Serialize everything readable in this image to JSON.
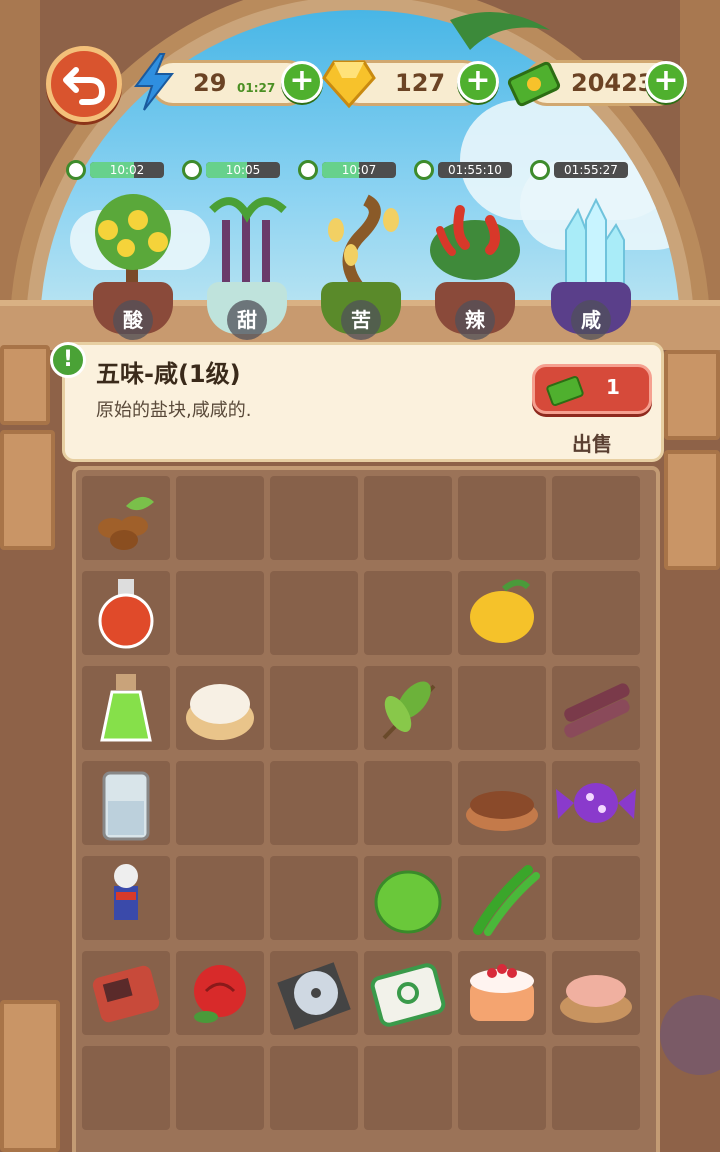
{
  "top_bar": {
    "energy": {
      "value": "29",
      "timer": "01:27",
      "icon": "lightning-icon"
    },
    "gems": {
      "value": "127",
      "icon": "gem-icon"
    },
    "cash": {
      "value": "20423",
      "icon": "cash-icon"
    },
    "plus_label": "+"
  },
  "plants": [
    {
      "timer": "10:02",
      "progress": 0.6,
      "label": "酸",
      "icon": "lemon-tree-icon"
    },
    {
      "timer": "10:05",
      "progress": 0.55,
      "label": "甜",
      "icon": "sugarcane-plant-icon"
    },
    {
      "timer": "10:07",
      "progress": 0.5,
      "label": "苦",
      "icon": "bitter-gourd-plant-icon"
    },
    {
      "timer": "01:55:10",
      "progress": 0.0,
      "label": "辣",
      "icon": "chili-plant-icon"
    },
    {
      "timer": "01:55:27",
      "progress": 0.0,
      "label": "咸",
      "icon": "salt-crystal-icon"
    }
  ],
  "info": {
    "badge": "!",
    "title": "五味-咸(1级)",
    "description": "原始的盐块,咸咸的.",
    "sell_price": "1",
    "sell_label": "出售"
  },
  "grid_items": [
    {
      "name": "coffee-beans-icon"
    },
    {
      "name": "red-potion-icon"
    },
    {
      "name": "lemon-icon"
    },
    {
      "name": "green-potion-icon"
    },
    {
      "name": "cream-puff-icon"
    },
    {
      "name": "tea-leaves-icon"
    },
    {
      "name": "sugarcane-icon"
    },
    {
      "name": "salt-jar-icon"
    },
    {
      "name": "spice-bowl-icon"
    },
    {
      "name": "candy-icon"
    },
    {
      "name": "hero-figure-icon"
    },
    {
      "name": "lime-icon"
    },
    {
      "name": "green-chili-icon"
    },
    {
      "name": "game-console-icon"
    },
    {
      "name": "rose-icon"
    },
    {
      "name": "cd-disc-icon"
    },
    {
      "name": "mahjong-tile-icon"
    },
    {
      "name": "strawberry-cake-icon"
    },
    {
      "name": "salt-bowl-icon"
    }
  ],
  "colors": {
    "accent_green": "#4fb02e",
    "sell_red": "#d64a3a",
    "board": "#87614a"
  }
}
